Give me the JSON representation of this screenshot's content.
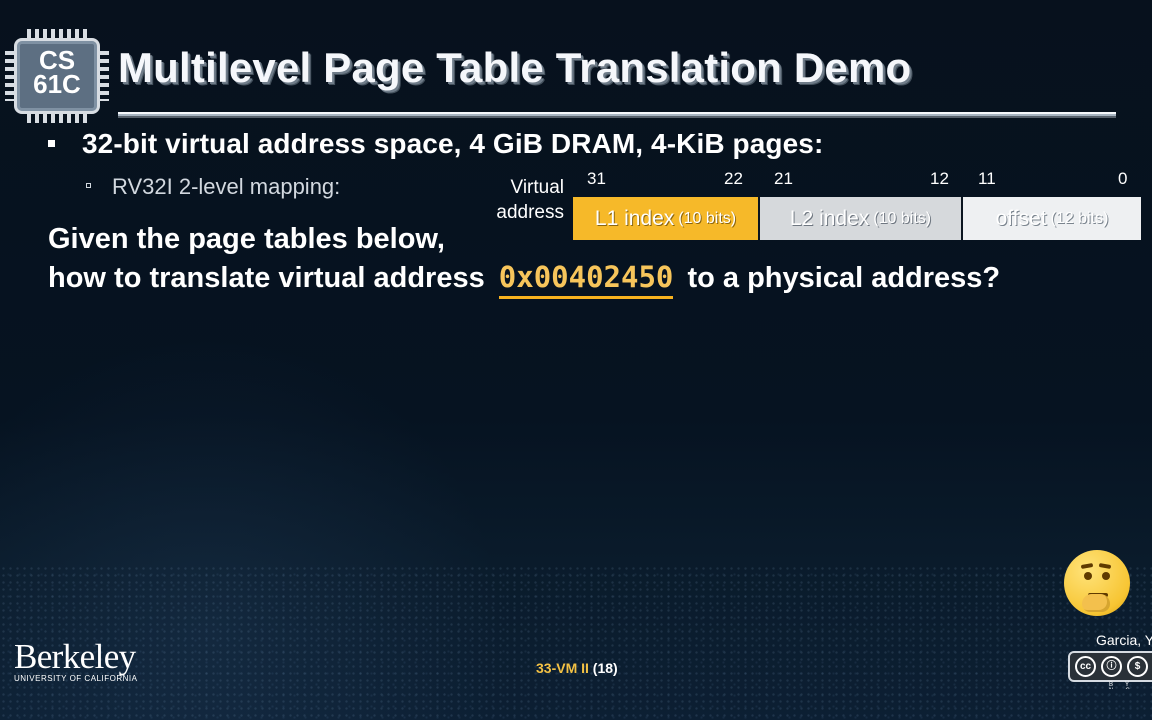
{
  "header": {
    "logo_line_1": "CS",
    "logo_line_2": "61C",
    "title": "Multilevel Page Table Translation Demo"
  },
  "content": {
    "bullet_main": "32-bit virtual address space, 4 GiB DRAM, 4-KiB pages:",
    "bullet_sub": "RV32I 2-level mapping:",
    "question_line_1": "Given the page tables below,",
    "question_line_2_prefix": "how to translate virtual address",
    "virtual_address": "0x00402450",
    "question_line_2_suffix": "to a physical address?"
  },
  "diagram": {
    "label_line_1": "Virtual",
    "label_line_2": "address",
    "bits": {
      "l1_start": "31",
      "l1_end": "22",
      "l2_start": "21",
      "l2_end": "12",
      "offset_start": "11",
      "offset_end": "0"
    },
    "fields": {
      "l1_label": "L1 index",
      "l1_bits": "(10 bits)",
      "l2_label": "L2 index",
      "l2_bits": "(10 bits)",
      "offset_label": "offset",
      "offset_bits": "(12 bits)"
    },
    "colors": {
      "l1": "#f6b929",
      "l2": "#d6d9dc",
      "offset": "#eef0f2"
    }
  },
  "footer": {
    "institution": "Berkeley",
    "institution_sub": "UNIVERSITY OF CALIFORNIA",
    "slide_code": "33-VM II",
    "slide_number": "(18)",
    "author_fragment": "Garcia, Yo",
    "license_marks": {
      "cc": "cc",
      "by": "BY",
      "nc": "NC"
    },
    "icon": "thinking-face-icon"
  }
}
